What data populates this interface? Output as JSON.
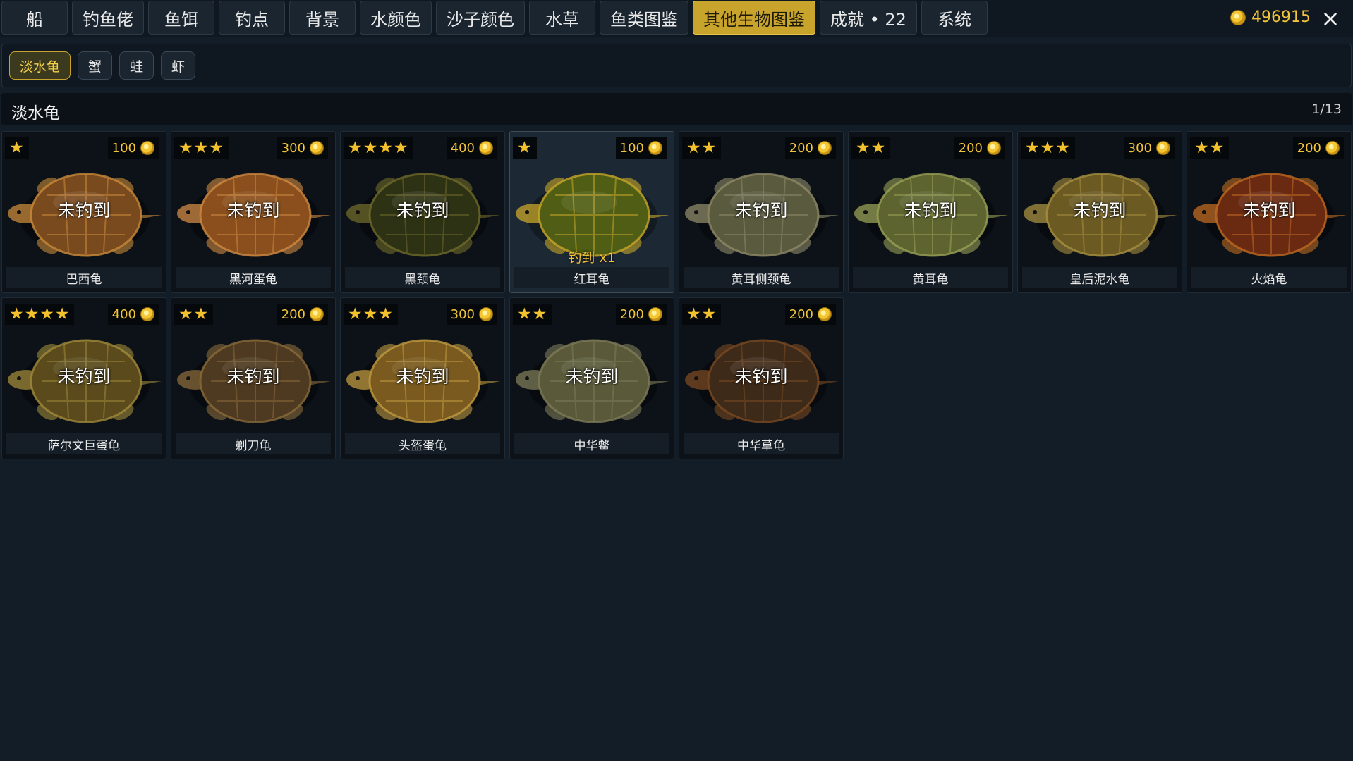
{
  "topbar": {
    "tabs": [
      {
        "label": "船",
        "width": 94
      },
      {
        "label": "钓鱼佬",
        "width": 94
      },
      {
        "label": "鱼饵",
        "width": 94
      },
      {
        "label": "钓点",
        "width": 94
      },
      {
        "label": "背景",
        "width": 94
      },
      {
        "label": "水颜色",
        "width": 94
      },
      {
        "label": "沙子颜色",
        "width": 118
      },
      {
        "label": "水草",
        "width": 94
      },
      {
        "label": "鱼类图鉴",
        "width": 118
      },
      {
        "label": "其他生物图鉴",
        "width": 166,
        "active": true
      },
      {
        "label": "成就 • 22",
        "width": 130
      },
      {
        "label": "系统",
        "width": 94
      }
    ],
    "coins": "496915",
    "close_icon": "×"
  },
  "subtabs": [
    {
      "label": "淡水龟",
      "active": true
    },
    {
      "label": "蟹"
    },
    {
      "label": "蛙"
    },
    {
      "label": "虾"
    }
  ],
  "section": {
    "title": "淡水龟",
    "page": "1/13"
  },
  "cards": [
    {
      "name": "巴西龟",
      "stars": "★",
      "price": "100",
      "status": "未钓到",
      "caught": false,
      "shell": "#7a4a1f",
      "accent": "#c98a3a"
    },
    {
      "name": "黑河蛋龟",
      "stars": "★★★",
      "price": "300",
      "status": "未钓到",
      "caught": false,
      "shell": "#8a4f1c",
      "accent": "#d08a44"
    },
    {
      "name": "黑颈龟",
      "stars": "★★★★",
      "price": "400",
      "status": "未钓到",
      "caught": false,
      "shell": "#2e3214",
      "accent": "#6f6a2a"
    },
    {
      "name": "红耳龟",
      "stars": "★",
      "price": "100",
      "status": "",
      "caught": true,
      "caught_label": "钓到 x1",
      "shell": "#4f5e14",
      "accent": "#c8a628"
    },
    {
      "name": "黄耳侧颈龟",
      "stars": "★★",
      "price": "200",
      "status": "未钓到",
      "caught": false,
      "shell": "#5a5a3e",
      "accent": "#8e8a68"
    },
    {
      "name": "黄耳龟",
      "stars": "★★",
      "price": "200",
      "status": "未钓到",
      "caught": false,
      "shell": "#5d6430",
      "accent": "#9aa056"
    },
    {
      "name": "皇后泥水龟",
      "stars": "★★★",
      "price": "300",
      "status": "未钓到",
      "caught": false,
      "shell": "#6b5a22",
      "accent": "#a89040"
    },
    {
      "name": "火焰龟",
      "stars": "★★",
      "price": "200",
      "status": "未钓到",
      "caught": false,
      "shell": "#6a2a12",
      "accent": "#c06a22"
    },
    {
      "name": "萨尔文巨蛋龟",
      "stars": "★★★★",
      "price": "400",
      "status": "未钓到",
      "caught": false,
      "shell": "#5a4a1c",
      "accent": "#a08a3a"
    },
    {
      "name": "剃刀龟",
      "stars": "★★",
      "price": "200",
      "status": "未钓到",
      "caught": false,
      "shell": "#4e3a20",
      "accent": "#8a6a3a"
    },
    {
      "name": "头盔蛋龟",
      "stars": "★★★",
      "price": "300",
      "status": "未钓到",
      "caught": false,
      "shell": "#7a5a1e",
      "accent": "#c09a40"
    },
    {
      "name": "中华鳖",
      "stars": "★★",
      "price": "200",
      "status": "未钓到",
      "caught": false,
      "shell": "#5a5a3a",
      "accent": "#7e7c58"
    },
    {
      "name": "中华草龟",
      "stars": "★★",
      "price": "200",
      "status": "未钓到",
      "caught": false,
      "shell": "#3e2a18",
      "accent": "#7a4a22"
    }
  ]
}
